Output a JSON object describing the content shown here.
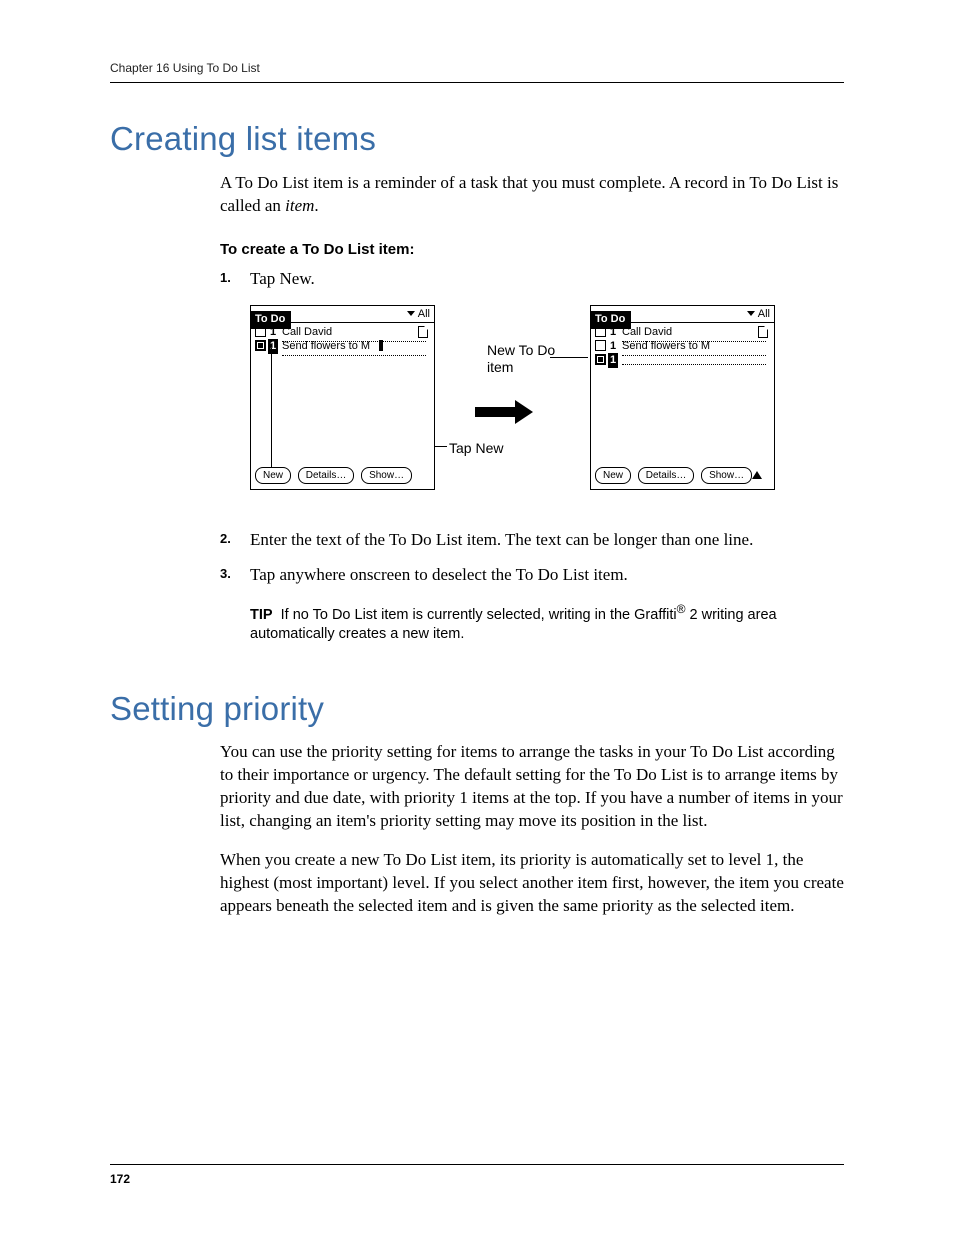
{
  "header": {
    "running_head": "Chapter 16    Using To Do List"
  },
  "section1": {
    "title": "Creating list items",
    "intro_a": "A To Do List item is a reminder of a task that you must complete. A record in To Do List is called an ",
    "intro_italic": "item",
    "intro_b": ".",
    "subhead": "To create a To Do List item:",
    "steps": {
      "s1": {
        "num": "1.",
        "text": "Tap New."
      },
      "s2": {
        "num": "2.",
        "text": "Enter the text of the To Do List item. The text can be longer than one line."
      },
      "s3": {
        "num": "3.",
        "text": "Tap anywhere onscreen to deselect the To Do List item."
      }
    },
    "figure": {
      "screen_title": "To Do",
      "dropdown": "All",
      "items": {
        "i1": {
          "pri": "1",
          "text": "Call David"
        },
        "i2": {
          "pri": "1",
          "text": "Send flowers to M"
        }
      },
      "buttons": {
        "new": "New",
        "details": "Details…",
        "show": "Show…"
      },
      "callouts": {
        "new_item": "New To Do item",
        "tap_new": "Tap New"
      }
    },
    "tip": {
      "label": "TIP",
      "text_a": "If no To Do List item is currently selected, writing in the Graffiti",
      "reg": "®",
      "text_b": " 2 writing area automatically creates a new item."
    }
  },
  "section2": {
    "title": "Setting priority",
    "p1": "You can use the priority setting for items to arrange the tasks in your To Do List according to their importance or urgency. The default setting for the To Do List is to arrange items by priority and due date, with priority 1 items at the top. If you have a number of items in your list, changing an item's priority setting may move its position in the list.",
    "p2": "When you create a new To Do List item, its priority is automatically set to level 1, the highest (most important) level. If you select another item first, however, the item you create appears beneath the selected item and is given the same priority as the selected item."
  },
  "footer": {
    "page": "172"
  }
}
